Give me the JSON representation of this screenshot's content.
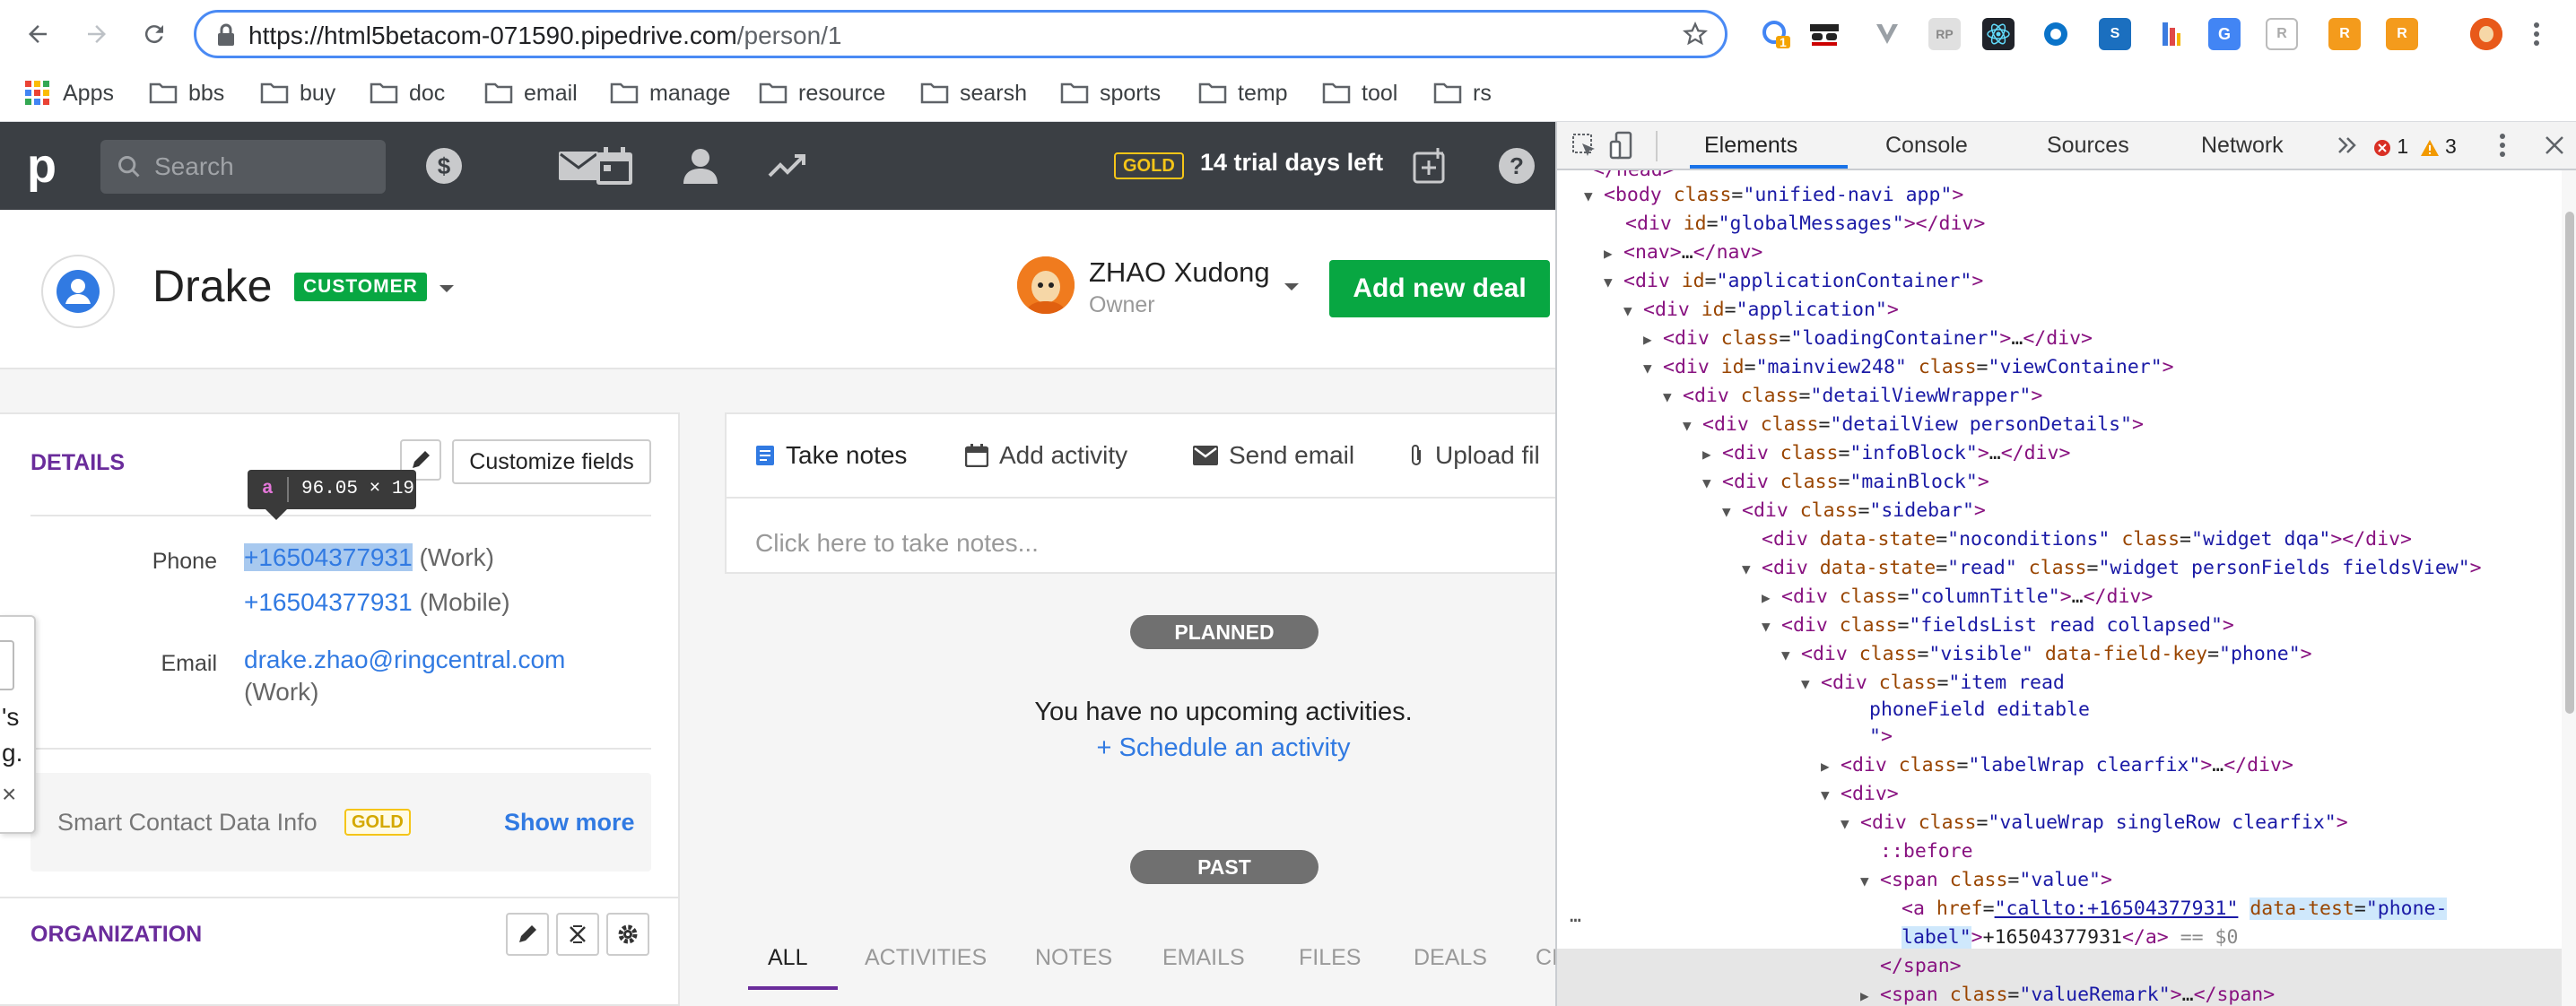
{
  "browser": {
    "url_host": "https://html5betacom-071590.pipedrive.com",
    "url_path": "/person/1",
    "extension_badge": "1"
  },
  "bookmarks": [
    "Apps",
    "bbs",
    "buy",
    "doc",
    "email",
    "manage",
    "resource",
    "searsh",
    "sports",
    "temp",
    "tool",
    "rs"
  ],
  "header": {
    "logo": "p",
    "search_placeholder": "Search",
    "gold": "GOLD",
    "trial": "14 trial days left"
  },
  "person": {
    "name": "Drake",
    "label": "CUSTOMER",
    "owner_name": "ZHAO Xudong",
    "owner_role": "Owner",
    "add_deal": "Add new deal"
  },
  "details": {
    "title": "DETAILS",
    "customize": "Customize fields",
    "phone_label": "Phone",
    "phone1": "+16504377931",
    "phone1_type": "(Work)",
    "phone2": "+16504377931",
    "phone2_type": "(Mobile)",
    "email_label": "Email",
    "email": "drake.zhao@ringcentral.com",
    "email_type": "(Work)",
    "smart_info": "Smart Contact Data Info",
    "smart_gold": "GOLD",
    "show_more": "Show more"
  },
  "tooltip": {
    "tag": "a",
    "size": "96.05 × 19"
  },
  "popup_fragments": [
    "'s",
    "g.",
    "×"
  ],
  "organization": {
    "title": "ORGANIZATION"
  },
  "notes": {
    "tabs": [
      "Take notes",
      "Add activity",
      "Send email",
      "Upload fil"
    ],
    "placeholder": "Click here to take notes..."
  },
  "timeline": {
    "planned": "PLANNED",
    "no_activity": "You have no upcoming activities.",
    "schedule": "+ Schedule an activity",
    "past": "PAST"
  },
  "feed_tabs": [
    "ALL",
    "ACTIVITIES",
    "NOTES",
    "EMAILS",
    "FILES",
    "DEALS",
    "CI"
  ],
  "devtools": {
    "tabs": [
      "Elements",
      "Console",
      "Sources",
      "Network"
    ],
    "errors": "1",
    "warnings": "3",
    "dollar": "== $0"
  }
}
